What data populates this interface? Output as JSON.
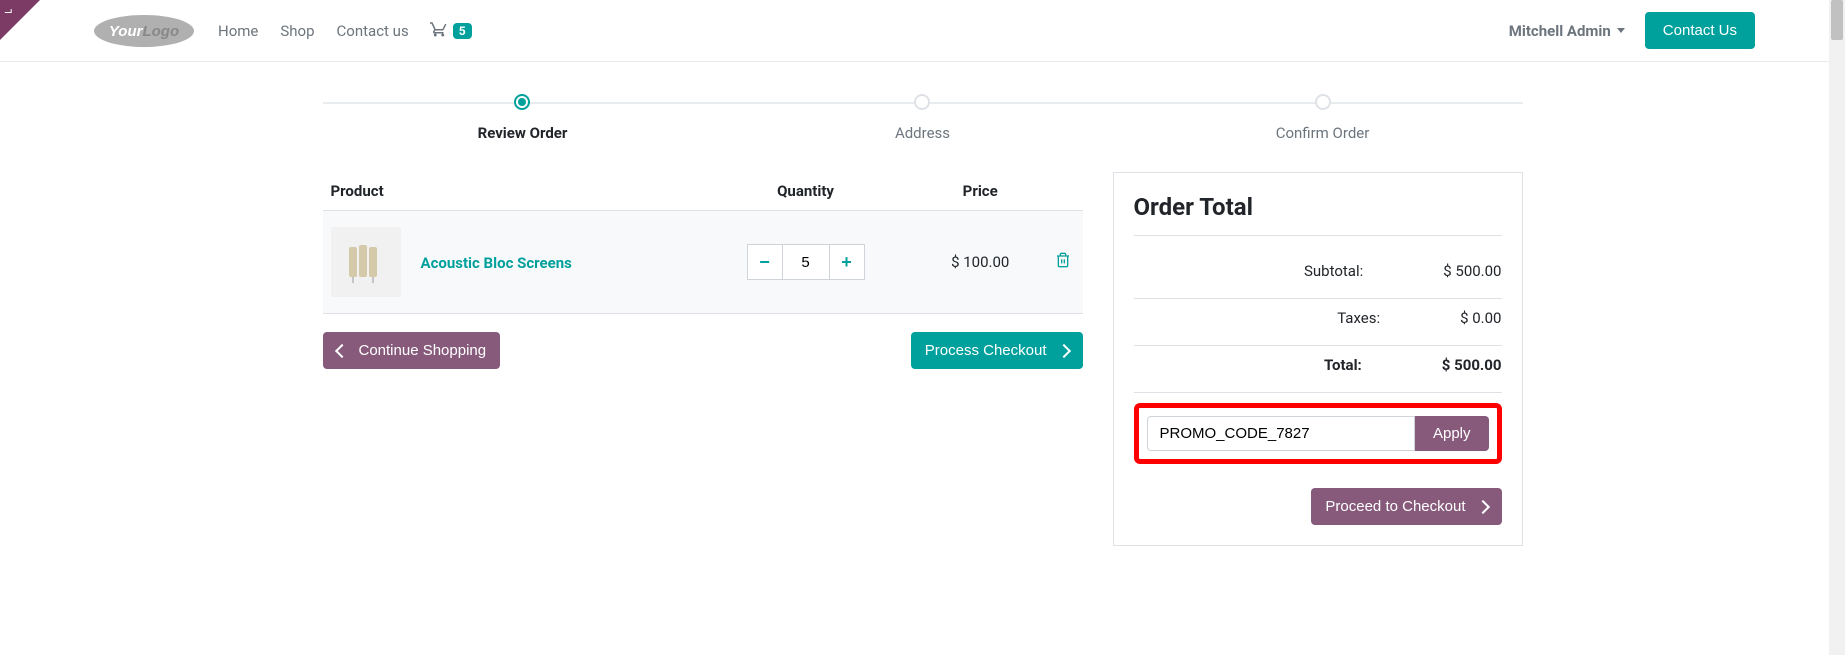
{
  "nav": {
    "home": "Home",
    "shop": "Shop",
    "contact": "Contact us",
    "cart_count": "5",
    "user": "Mitchell Admin",
    "contact_btn": "Contact Us"
  },
  "wizard": {
    "steps": [
      "Review Order",
      "Address",
      "Confirm Order"
    ],
    "active": 0
  },
  "table": {
    "headers": {
      "product": "Product",
      "qty": "Quantity",
      "price": "Price"
    },
    "row": {
      "name": "Acoustic Bloc Screens",
      "qty": "5",
      "price": "$ 100.00"
    }
  },
  "actions": {
    "continue": "Continue Shopping",
    "process": "Process Checkout"
  },
  "summary": {
    "title": "Order Total",
    "subtotal_label": "Subtotal:",
    "subtotal": "$ 500.00",
    "taxes_label": "Taxes:",
    "taxes": "$ 0.00",
    "total_label": "Total:",
    "total": "$ 500.00",
    "promo_value": "PROMO_CODE_7827",
    "apply": "Apply",
    "proceed": "Proceed to Checkout"
  }
}
